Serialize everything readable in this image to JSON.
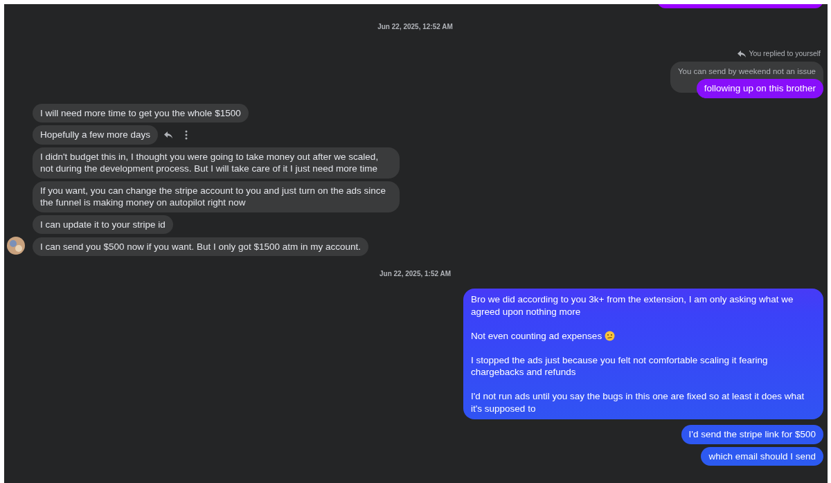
{
  "messages": [
    {
      "kind": "clipped_outgoing"
    },
    {
      "kind": "timestamp",
      "text": "Jun 22, 2025, 12:52 AM"
    },
    {
      "kind": "reply_label",
      "text": "You replied to yourself"
    },
    {
      "kind": "quote",
      "text": "You can send by weekend not an issue"
    },
    {
      "kind": "outgoing",
      "text": "following up on this brother"
    },
    {
      "kind": "incoming",
      "text": "I will need more time to get you the whole $1500"
    },
    {
      "kind": "incoming",
      "text": "Hopefully a few more days",
      "actions_shown": true
    },
    {
      "kind": "incoming",
      "text": "I didn't budget this in, I thought you were going to take money out after we scaled, not during the development process. But I will take care of it I just need more time"
    },
    {
      "kind": "incoming",
      "text": "If you want, you can change the stripe account to you and just turn on the ads since the funnel is making money on autopilot right now"
    },
    {
      "kind": "incoming",
      "text": "I can update it to your stripe id"
    },
    {
      "kind": "incoming",
      "text": "I can send you $500 now if you want. But I only got $1500 atm in my account.",
      "avatar": true
    },
    {
      "kind": "timestamp",
      "text": "Jun 22, 2025, 1:52 AM"
    },
    {
      "kind": "outgoing_paragraphs",
      "paragraphs": [
        {
          "text": "Bro we did according to you 3k+ from the extension, I am only asking what we agreed upon nothing more"
        },
        {
          "text": "Not even counting ad expenses",
          "emoji": true
        },
        {
          "text": "I stopped the ads just because you felt not comfortable scaling it fearing chargebacks and refunds"
        },
        {
          "text": "I'd not run ads until you say the bugs in this one are fixed so at least it does what it's supposed to"
        }
      ]
    },
    {
      "kind": "outgoing",
      "text": "I'd send the stripe link for $500"
    },
    {
      "kind": "outgoing",
      "text": "which email should I send"
    }
  ]
}
